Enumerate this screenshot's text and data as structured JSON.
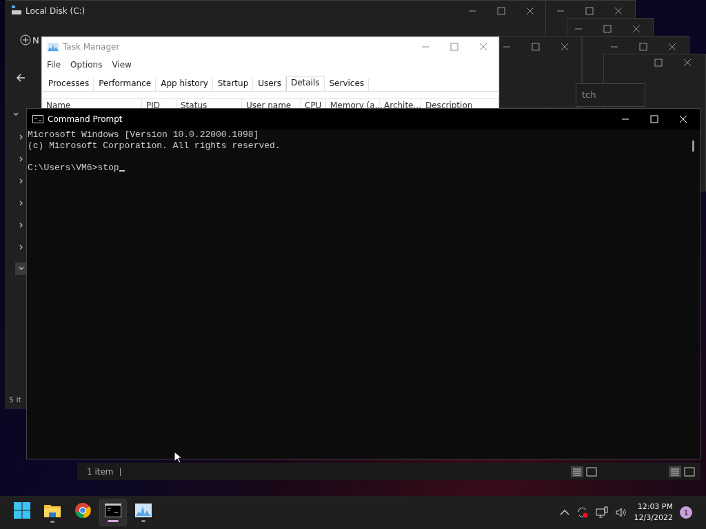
{
  "explorer": {
    "title": "Local Disk (C:)",
    "new_label": "N",
    "item_count": "5 it",
    "status": "1 item",
    "tree_toggles": [
      {
        "expanded": true,
        "selected": false
      },
      {
        "expanded": false,
        "selected": false
      },
      {
        "expanded": false,
        "selected": false
      },
      {
        "expanded": false,
        "selected": false
      },
      {
        "expanded": false,
        "selected": false
      },
      {
        "expanded": false,
        "selected": false
      },
      {
        "expanded": false,
        "selected": false
      },
      {
        "expanded": true,
        "selected": true
      }
    ]
  },
  "background_search": {
    "placeholder": "tch"
  },
  "task_manager": {
    "title": "Task Manager",
    "menu": [
      "File",
      "Options",
      "View"
    ],
    "tabs": [
      {
        "label": "Processes",
        "selected": false
      },
      {
        "label": "Performance",
        "selected": false
      },
      {
        "label": "App history",
        "selected": false
      },
      {
        "label": "Startup",
        "selected": false
      },
      {
        "label": "Users",
        "selected": false
      },
      {
        "label": "Details",
        "selected": true
      },
      {
        "label": "Services",
        "selected": false
      }
    ],
    "columns": [
      "Name",
      "PID",
      "Status",
      "User name",
      "CPU",
      "Memory (a...",
      "Archite...",
      "Description"
    ]
  },
  "command_prompt": {
    "title": "Command Prompt",
    "lines": [
      "Microsoft Windows [Version 10.0.22000.1098]",
      "(c) Microsoft Corporation. All rights reserved."
    ],
    "prompt": "C:\\Users\\VM6>stop"
  },
  "taskbar": {
    "apps": [
      {
        "kind": "start",
        "running": false,
        "selected": false
      },
      {
        "kind": "folder",
        "running": true,
        "selected": false
      },
      {
        "kind": "browser",
        "running": false,
        "selected": false
      },
      {
        "kind": "terminal",
        "running": true,
        "selected": true
      },
      {
        "kind": "monitor",
        "running": true,
        "selected": false
      }
    ],
    "time": "12:03 PM",
    "date": "12/3/2022",
    "notification_count": "1"
  }
}
